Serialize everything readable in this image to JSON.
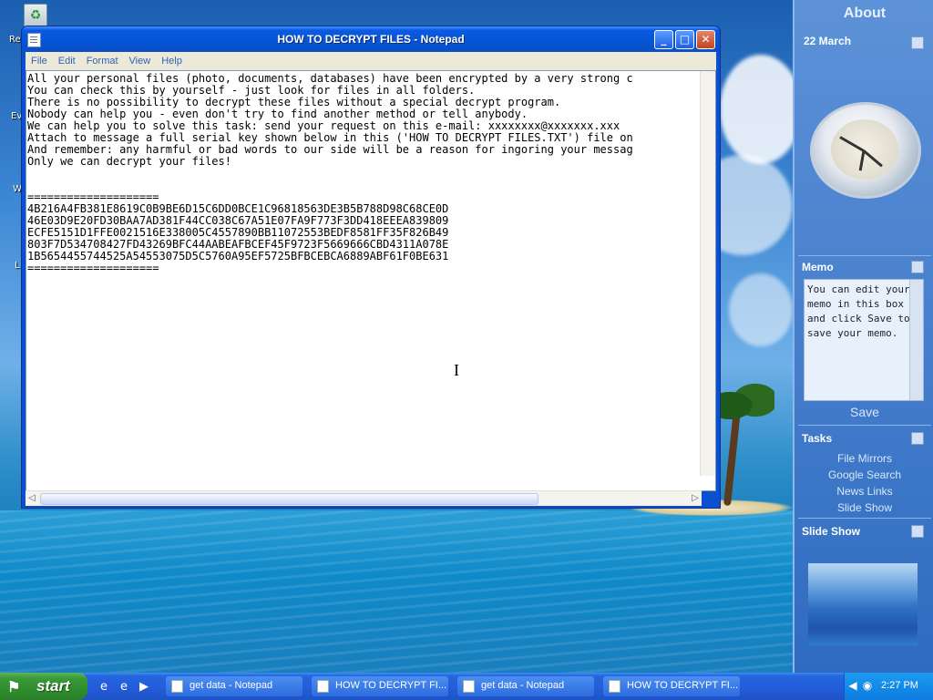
{
  "desktop": {
    "icon_labels": [
      "Re",
      "Ev",
      "W",
      "L"
    ]
  },
  "notepad": {
    "title": "HOW TO DECRYPT FILES - Notepad",
    "menu": [
      "File",
      "Edit",
      "Format",
      "View",
      "Help"
    ],
    "content": "All your personal files (photo, documents, databases) have been encrypted by a very strong c\nYou can check this by yourself - just look for files in all folders.\nThere is no possibility to decrypt these files without a special decrypt program.\nNobody can help you - even don't try to find another method or tell anybody.\nWe can help you to solve this task: send your request on this e-mail: xxxxxxxx@xxxxxxx.xxx\nAttach to message a full serial key shown below in this ('HOW TO DECRYPT FILES.TXT') file on\nAnd remember: any harmful or bad words to our side will be a reason for ingoring your messag\nOnly we can decrypt your files!\n\n\n====================\n4B216A4FB381E8619C0B9BE6D15C6DD0BCE1C96818563DE3B5B788D98C68CE0D\n46E03D9E20FD30BAA7AD381F44CC038C67A51E07FA9F773F3DD418EEEA839809\nECFE5151D1FFE0021516E338005C4557890BB11072553BEDF8581FF35F826B49\n803F7D534708427FD43269BFC44AABEAFBCEF45F9723F5669666CBD4311A078E\n1B5654455744525A54553075D5C5760A95EF5725BFBCEBCA6889ABF61F0BE631\n===================="
  },
  "sidebar": {
    "header": "About",
    "date": "22 March",
    "memo_title": "Memo",
    "memo_text": "You can edit your memo in this box and click Save to save your memo.",
    "save_label": "Save",
    "tasks_title": "Tasks",
    "tasks": [
      "File Mirrors",
      "Google Search",
      "News Links",
      "Slide Show"
    ],
    "slideshow_title": "Slide Show"
  },
  "taskbar": {
    "start_label": "start",
    "buttons": [
      "get data - Notepad",
      "HOW TO DECRYPT FI...",
      "get data - Notepad",
      "HOW TO DECRYPT FI..."
    ],
    "clock": "2:27 PM"
  }
}
